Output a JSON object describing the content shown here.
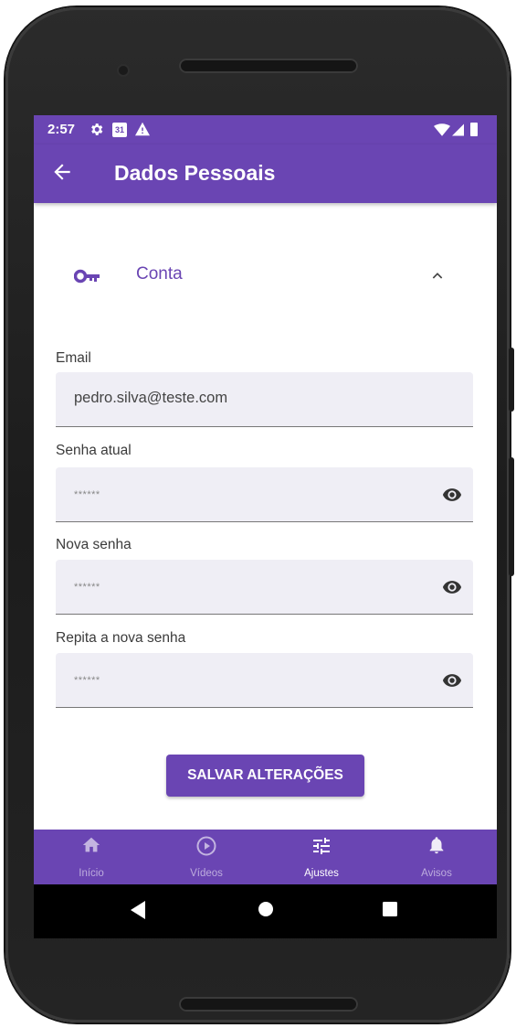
{
  "status_bar": {
    "time": "2:57",
    "calendar_day": "31"
  },
  "app_bar": {
    "title": "Dados Pessoais"
  },
  "section": {
    "label": "Conta",
    "icon": "key-icon",
    "expanded": true
  },
  "form": {
    "email": {
      "label": "Email",
      "value": "pedro.silva@teste.com"
    },
    "current_password": {
      "label": "Senha atual",
      "value": "******"
    },
    "new_password": {
      "label": "Nova senha",
      "value": "******"
    },
    "repeat_password": {
      "label": "Repita a nova senha",
      "value": "******"
    }
  },
  "save_button": {
    "label": "SALVAR ALTERAÇÕES"
  },
  "bottom_nav": {
    "items": [
      {
        "label": "Início",
        "icon": "home-icon",
        "active": false
      },
      {
        "label": "Vídeos",
        "icon": "play-circle-icon",
        "active": false
      },
      {
        "label": "Ajustes",
        "icon": "settings-sliders-icon",
        "active": true
      },
      {
        "label": "Avisos",
        "icon": "bell-icon",
        "active": false
      }
    ]
  },
  "colors": {
    "primary": "#6a45b3",
    "field_background": "#efeef5",
    "nav_inactive": "rgba(255,255,255,0.55)"
  }
}
